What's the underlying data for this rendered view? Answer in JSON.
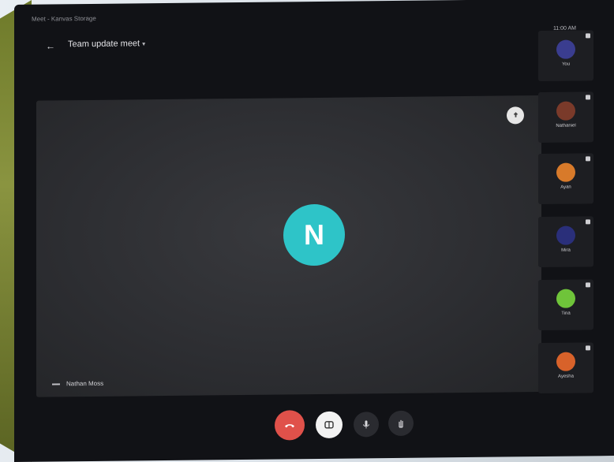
{
  "window": {
    "title": "Meet - Kanvas Storage"
  },
  "status": {
    "clock": "11:00 AM"
  },
  "meeting": {
    "title": "Team update meet",
    "caret": "▾"
  },
  "main_video": {
    "avatar_letter": "N",
    "participant_name": "Nathan Moss"
  },
  "participants": [
    {
      "name": "You",
      "avatar_color": "#3a3d8f"
    },
    {
      "name": "Nathaniel",
      "avatar_color": "#7a3a2a"
    },
    {
      "name": "Ayan",
      "avatar_color": "#d87a2a"
    },
    {
      "name": "Mira",
      "avatar_color": "#2a2f7a"
    },
    {
      "name": "Tina",
      "avatar_color": "#6fc43a"
    },
    {
      "name": "Ayesha",
      "avatar_color": "#d8622a"
    }
  ],
  "controls": {
    "end_call_color": "#e0514a",
    "captions_color": "#f2f2f2",
    "mic_color": "#2a2b30",
    "hand_color": "#2a2b30"
  }
}
